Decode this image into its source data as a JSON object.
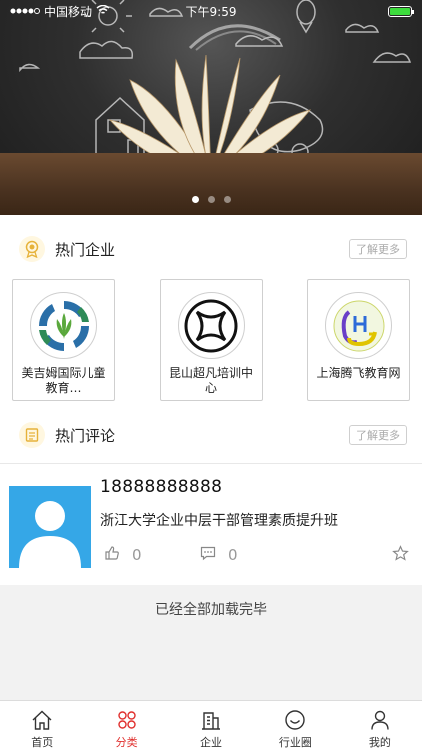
{
  "status_bar": {
    "carrier": "中国移动",
    "time": "下午9:59"
  },
  "banner": {
    "slides": [
      true,
      false,
      false
    ],
    "battery_level": 1.0
  },
  "hot_companies": {
    "title": "热门企业",
    "more_label": "了解更多",
    "items": [
      {
        "name": "美吉姆国际儿童教育…"
      },
      {
        "name": "昆山超凡培训中心"
      },
      {
        "name": "上海腾飞教育网"
      }
    ]
  },
  "hot_comments": {
    "title": "热门评论",
    "more_label": "了解更多",
    "items": [
      {
        "user": "18888888888",
        "content": "浙江大学企业中层干部管理素质提升班",
        "likes": "0",
        "comments": "0"
      }
    ]
  },
  "footer_text": "已经全部加载完毕",
  "tabbar": {
    "tabs": [
      {
        "label": "首页",
        "icon": "home-icon"
      },
      {
        "label": "分类",
        "icon": "category-icon"
      },
      {
        "label": "企业",
        "icon": "building-icon"
      },
      {
        "label": "行业圈",
        "icon": "circle-face-icon"
      },
      {
        "label": "我的",
        "icon": "user-icon"
      }
    ],
    "active_color": "#e0302e"
  }
}
